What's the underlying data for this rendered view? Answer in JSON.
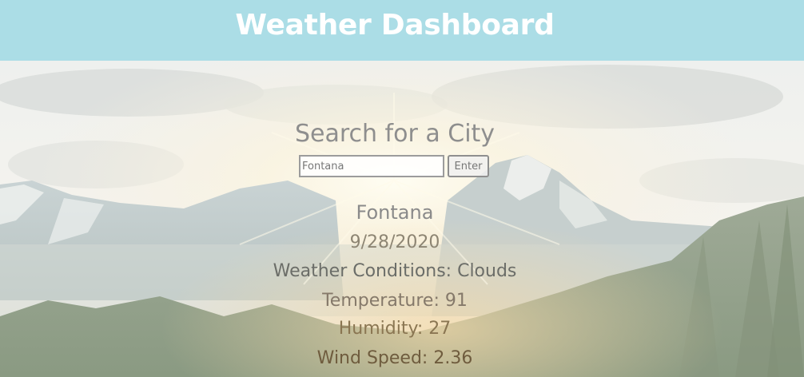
{
  "header": {
    "title": "Weather Dashboard"
  },
  "search": {
    "title": "Search for a City",
    "value": "Fontana",
    "button_label": "Enter"
  },
  "result": {
    "city": "Fontana",
    "date": "9/28/2020",
    "conditions": "Weather Conditions: Clouds",
    "temperature": "Temperature: 91",
    "humidity": "Humidity: 27",
    "wind_speed": "Wind Speed: 2.36"
  },
  "colors": {
    "header_bg": "#abdde6",
    "header_text": "#ffffff",
    "title_text": "#8e8e8e"
  }
}
